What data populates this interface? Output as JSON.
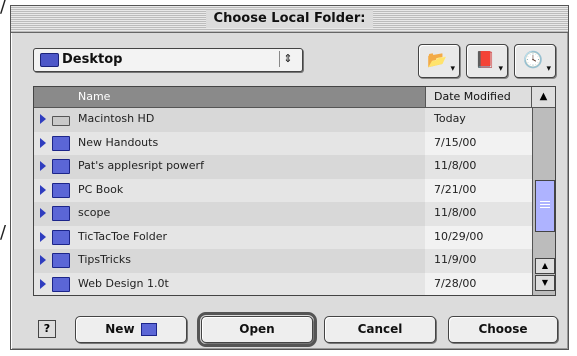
{
  "dialog": {
    "title": "Choose Local Folder:"
  },
  "location": {
    "popup_label": "Desktop",
    "popup_arrows": "⇕"
  },
  "toolbar": [
    {
      "name": "folder-shortcuts-button",
      "glyph": "📂"
    },
    {
      "name": "favorites-button",
      "glyph": "📕"
    },
    {
      "name": "recent-button",
      "glyph": "🕓"
    }
  ],
  "list": {
    "columns": {
      "name": "Name",
      "date": "Date Modified",
      "sort_glyph": "▲"
    },
    "rows": [
      {
        "name": "Macintosh HD",
        "date": "Today",
        "kind": "disk"
      },
      {
        "name": "New Handouts",
        "date": "7/15/00",
        "kind": "folder"
      },
      {
        "name": "Pat's applesript powerf",
        "date": "11/8/00",
        "kind": "folder"
      },
      {
        "name": "PC Book",
        "date": "7/21/00",
        "kind": "folder"
      },
      {
        "name": "scope",
        "date": "11/8/00",
        "kind": "folder"
      },
      {
        "name": "TicTacToe Folder",
        "date": "10/29/00",
        "kind": "folder"
      },
      {
        "name": "TipsTricks",
        "date": "11/9/00",
        "kind": "folder"
      },
      {
        "name": "Web Design 1.0t",
        "date": "7/28/00",
        "kind": "folder"
      }
    ]
  },
  "buttons": {
    "new": "New",
    "open": "Open",
    "cancel": "Cancel",
    "choose": "Choose",
    "help": "?"
  },
  "colors": {
    "accent": "#2f3dbf",
    "folder": "#5b66d6",
    "scroll_thumb": "#aeb3ff"
  },
  "edge_marks": {
    "top_left": "/",
    "mid_left": "/"
  }
}
